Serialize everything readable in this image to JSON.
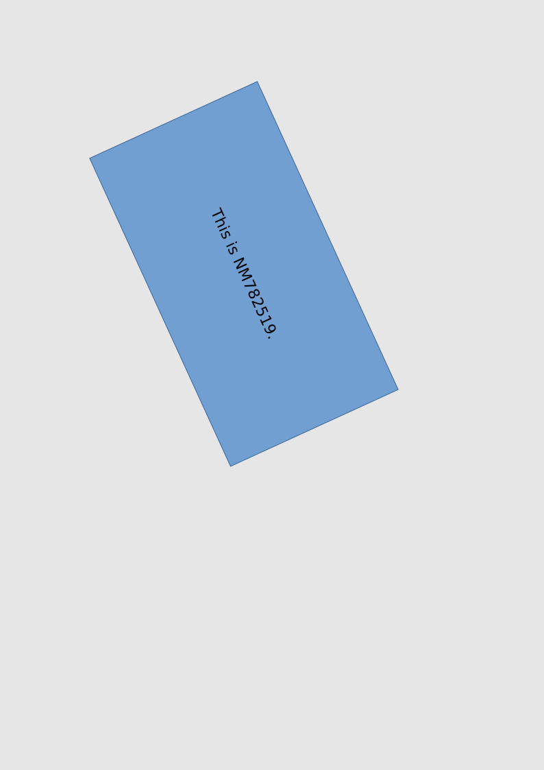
{
  "document": {
    "background_color": "#e6e6e6",
    "shape": {
      "fill_color": "#729fd2",
      "border_color": "#41689a",
      "text": "This is NM782519."
    }
  }
}
